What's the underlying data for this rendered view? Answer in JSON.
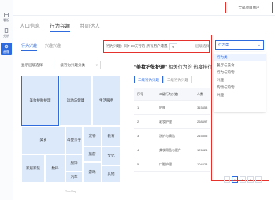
{
  "sidebar": {
    "items": [
      {
        "label": "看板",
        "icon": "dashboard-icon"
      },
      {
        "label": "分析",
        "icon": "document-icon"
      },
      {
        "label": "画像",
        "icon": "gear-icon"
      }
    ]
  },
  "header": {
    "user_label": "全部项目用户"
  },
  "tabs": [
    "人口信息",
    "行为兴趣",
    "共同达人"
  ],
  "subtabs": [
    "行为兴趣",
    "兴趣兴趣"
  ],
  "filter": {
    "text": "行为兴趣：同7 38天行的 所有用户遭遇",
    "value": "0"
  },
  "select": {
    "label": "层级选择",
    "value": "行为类",
    "options": [
      "行为类",
      "餐厅与美食",
      "行为与购物",
      "兴趣",
      "购物与购物",
      "兴趣"
    ]
  },
  "left": {
    "label": "显示层级选择",
    "select_value": "一级行为兴趣分类"
  },
  "treemap": {
    "cells": [
      {
        "label": "美妆护肤护理",
        "value": 30,
        "highlight": true
      },
      {
        "label": "运动与健康",
        "value": 14
      },
      {
        "label": "生活服务",
        "value": 12
      },
      {
        "label": "美食",
        "value": 10
      },
      {
        "label": "母婴亲子",
        "value": 6
      },
      {
        "label": "宠物",
        "value": 5
      },
      {
        "label": "教育",
        "value": 5
      },
      {
        "label": "旅游",
        "value": 5
      },
      {
        "label": "家居家装",
        "value": 4
      },
      {
        "label": "数码",
        "value": 4
      },
      {
        "label": "服饰",
        "value": 3
      },
      {
        "label": "汽车",
        "value": 2
      },
      {
        "label": "游戏",
        "value": 2
      },
      {
        "label": "文化",
        "value": 2
      },
      {
        "label": "其他",
        "value": 2
      }
    ],
    "caption": "TreeMap"
  },
  "right": {
    "title_prefix": "“美妆护肤护理”",
    "title_suffix": " 相关行为的 热度排行",
    "tabs": [
      "二级行为兴趣",
      "三级行为兴趣"
    ],
    "table": {
      "headers": [
        "序号",
        "二级行为兴趣",
        "人数"
      ],
      "rows": [
        [
          "1",
          "护肤",
          "315458"
        ],
        [
          "2",
          "彩妆护理",
          "268497"
        ],
        [
          "3",
          "洗护与清洁",
          "215305"
        ],
        [
          "4",
          "美妆用品与配件",
          "176324"
        ],
        [
          "5",
          "口腔护理",
          "104423"
        ]
      ]
    },
    "pager": [
      "<",
      "1",
      "2",
      "3",
      ">"
    ]
  },
  "colors": {
    "accent": "#2f6bdc",
    "highlight_box": "#e5322d",
    "treemap_fill": "#dbe9fb"
  }
}
